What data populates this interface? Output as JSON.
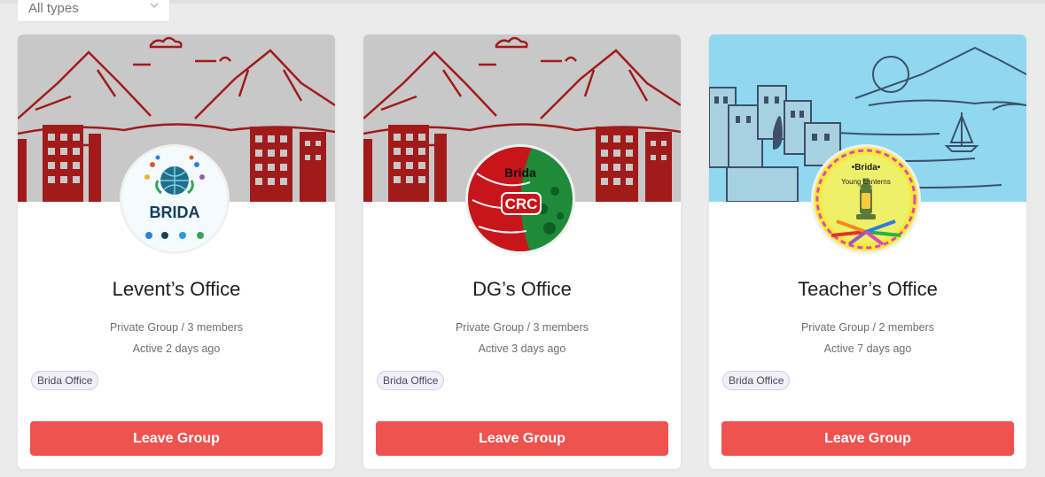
{
  "filter": {
    "value": "All types"
  },
  "colors": {
    "accent": "#ef5350",
    "tag_bg": "#f1eff9",
    "cover_red": "#a11b1b",
    "cover_blue": "#8fd8f0"
  },
  "groups": [
    {
      "name": "Levent’s Office",
      "privacy_members": "Private Group / 3 members",
      "activity": "Active 2 days ago",
      "tag": "Brida Office",
      "leave_label": "Leave Group",
      "avatar_text": "BRIDA",
      "cover_icon": "mountain-town-cover"
    },
    {
      "name": "DG’s Office",
      "privacy_members": "Private Group / 3 members",
      "activity": "Active 3 days ago",
      "tag": "Brida Office",
      "leave_label": "Leave Group",
      "avatar_text": "Brida",
      "avatar_subtext": "CRC",
      "cover_icon": "mountain-town-cover"
    },
    {
      "name": "Teacher’s Office",
      "privacy_members": "Private Group / 2 members",
      "activity": "Active 7 days ago",
      "tag": "Brida Office",
      "leave_label": "Leave Group",
      "avatar_text": "•Brida•",
      "avatar_subtext": "Young Lanterns",
      "cover_icon": "seaside-town-cover"
    }
  ]
}
